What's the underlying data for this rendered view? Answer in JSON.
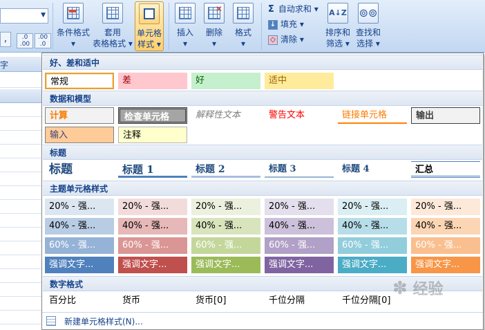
{
  "ribbon": {
    "buttons": [
      {
        "label": "条件格式",
        "sub": "▾"
      },
      {
        "label": "套用",
        "sub": "表格格式 ▾"
      },
      {
        "label": "单元格",
        "sub": "样式 ▾"
      },
      {
        "label": "插入",
        "sub": "▾"
      },
      {
        "label": "删除",
        "sub": "▾"
      },
      {
        "label": "格式",
        "sub": "▾"
      },
      {
        "label": "排序和",
        "sub": "筛选 ▾"
      },
      {
        "label": "查找和",
        "sub": "选择 ▾"
      }
    ],
    "small": {
      "autosum": "自动求和 ▾",
      "fill": "填充 ▾",
      "clear": "清除 ▾"
    },
    "number_buttons": [
      ".0 .00",
      ".00 .0"
    ]
  },
  "sheet": {
    "formula_label": "字"
  },
  "gallery": {
    "sections": [
      {
        "title": "好、差和适中"
      },
      {
        "title": "数据和模型"
      },
      {
        "title": "标题"
      },
      {
        "title": "主题单元格样式"
      },
      {
        "title": "数字格式"
      }
    ],
    "good_bad": [
      "常规",
      "差",
      "好",
      "适中"
    ],
    "data_model_row1": [
      "计算",
      "检查单元格",
      "解释性文本",
      "警告文本",
      "链接单元格",
      "输出"
    ],
    "data_model_row2": [
      "输入",
      "注释"
    ],
    "titles": [
      "标题",
      "标题 1",
      "标题 2",
      "标题 3",
      "标题 4",
      "汇总"
    ],
    "theme_20": [
      "20% - 强...",
      "20% - 强...",
      "20% - 强...",
      "20% - 强...",
      "20% - 强...",
      "20% - 强..."
    ],
    "theme_40": [
      "40% - 强...",
      "40% - 强...",
      "40% - 强...",
      "40% - 强...",
      "40% - 强...",
      "40% - 强..."
    ],
    "theme_60": [
      "60% - 强...",
      "60% - 强...",
      "60% - 强...",
      "60% - 强...",
      "60% - 强...",
      "60% - 强..."
    ],
    "theme_accent": [
      "强调文字...",
      "强调文字...",
      "强调文字...",
      "强调文字...",
      "强调文字...",
      "强调文字..."
    ],
    "number_formats": [
      "百分比",
      "货币",
      "货币[0]",
      "千位分隔",
      "千位分隔[0]"
    ],
    "footer": "新建单元格样式(N)..."
  },
  "watermark": "经验",
  "colors": {
    "accent1": "#4f81bd",
    "accent2": "#c0504d",
    "accent3": "#9bbb59",
    "accent4": "#8064a2",
    "accent5": "#4bacc6",
    "accent6": "#f79646"
  }
}
